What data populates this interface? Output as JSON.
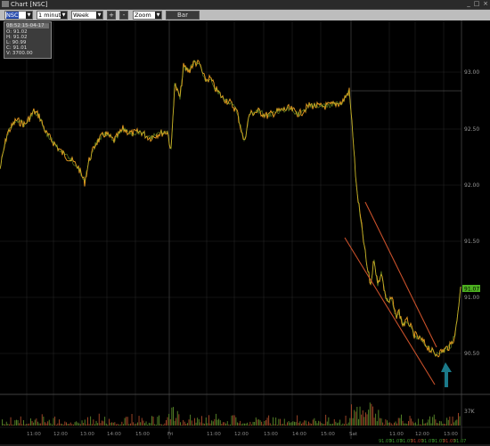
{
  "window": {
    "title": "Chart [NSC]"
  },
  "toolbar": {
    "symbol": "NSC",
    "interval": "1 minute",
    "range": "Week",
    "plus": "+",
    "minus": "-",
    "zoom": "Zoom",
    "bar": "Bar"
  },
  "info": {
    "header": "08:52 15-04-17",
    "lines": [
      "O: 91.02",
      "H: 91.02",
      "L: 90.99",
      "C: 91.01",
      "V: 3700.00"
    ]
  },
  "price_axis": {
    "ticks": [
      "93.00",
      "92.50",
      "92.00",
      "91.50",
      "91.00",
      "90.50"
    ],
    "last_price": "91.07"
  },
  "volume_axis": {
    "tick": "37K"
  },
  "time_axis": {
    "ticks": [
      "11:00",
      "12:00",
      "13:00",
      "14:00",
      "15:00",
      "Fri",
      "11:00",
      "12:00",
      "13:00",
      "14:00",
      "15:00",
      "Sat",
      "11:00",
      "12:00",
      "13:00"
    ]
  },
  "bottom_quotes": [
    "91.07",
    "91.07",
    "91.07",
    "91.07",
    "91.07",
    "91.07",
    "91.07",
    "91.07"
  ],
  "colors": {
    "background": "#000000",
    "price_line_up": "#f0a020",
    "price_line_alt": "#90c030",
    "trend_lines": "#c8502a",
    "arrow": "#1b7a8a",
    "last_price_bg": "#4caf20"
  }
}
